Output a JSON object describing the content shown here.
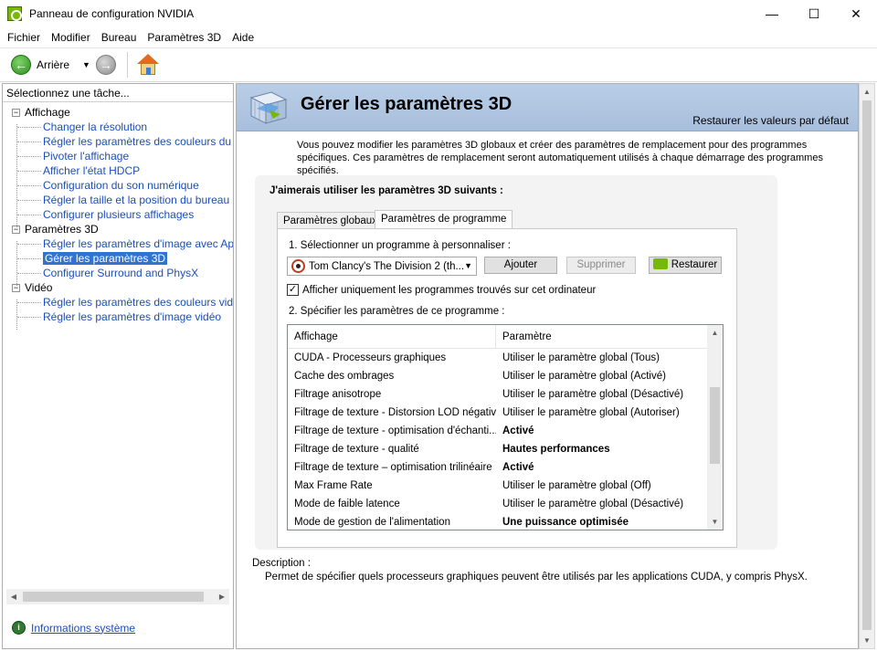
{
  "window": {
    "title": "Panneau de configuration NVIDIA",
    "minimize": "—",
    "maximize": "☐",
    "close": "✕"
  },
  "menu": [
    "Fichier",
    "Modifier",
    "Bureau",
    "Paramètres 3D",
    "Aide"
  ],
  "toolbar": {
    "back_label": "Arrière",
    "back_glyph": "←",
    "forward_glyph": "→",
    "dropdown_glyph": "▼"
  },
  "left_panel": {
    "header": "Sélectionnez une tâche...",
    "groups": [
      {
        "label": "Affichage",
        "items": [
          "Changer la résolution",
          "Régler les paramètres des couleurs du bureau",
          "Pivoter l'affichage",
          "Afficher l'état HDCP",
          "Configuration du son numérique",
          "Régler la taille et la position du bureau",
          "Configurer plusieurs affichages"
        ]
      },
      {
        "label": "Paramètres 3D",
        "items": [
          "Régler les paramètres d'image avec Aperçu",
          "Gérer les paramètres 3D",
          "Configurer Surround and PhysX"
        ]
      },
      {
        "label": "Vidéo",
        "items": [
          "Régler les paramètres des couleurs vidéo",
          "Régler les paramètres d'image vidéo"
        ]
      }
    ],
    "selected_item": "Gérer les paramètres 3D",
    "system_info_link": "Informations système",
    "expander_glyph": "−"
  },
  "main": {
    "title": "Gérer les paramètres 3D",
    "restore_defaults": "Restaurer les valeurs par défaut",
    "intro": "Vous pouvez modifier les paramètres 3D globaux et créer des paramètres de remplacement pour des programmes spécifiques. Ces paramètres de remplacement seront automatiquement utilisés à chaque démarrage des programmes spécifiés.",
    "section_heading": "J'aimerais utiliser les paramètres 3D suivants :",
    "tabs": [
      "Paramètres globaux",
      "Paramètres de programme"
    ],
    "active_tab": "Paramètres de programme",
    "step1_label": "1. Sélectionner un programme à personnaliser :",
    "program_selected": "Tom Clancy's The Division 2 (th...",
    "buttons": {
      "add": "Ajouter",
      "remove": "Supprimer",
      "restore": "Restaurer"
    },
    "checkbox_label": "Afficher uniquement les programmes trouvés sur cet ordinateur",
    "checkbox_checked": true,
    "checkbox_glyph": "✓",
    "step2_label": "2. Spécifier les paramètres de ce programme :",
    "grid": {
      "columns": [
        "Affichage",
        "Paramètre"
      ],
      "rows": [
        {
          "feature": "CUDA - Processeurs graphiques",
          "setting": "Utiliser le paramètre global (Tous)",
          "bold": false
        },
        {
          "feature": "Cache des ombrages",
          "setting": "Utiliser le paramètre global (Activé)",
          "bold": false
        },
        {
          "feature": "Filtrage anisotrope",
          "setting": "Utiliser le paramètre global (Désactivé)",
          "bold": false
        },
        {
          "feature": "Filtrage de texture - Distorsion LOD négative",
          "setting": "Utiliser le paramètre global (Autoriser)",
          "bold": false
        },
        {
          "feature": "Filtrage de texture - optimisation d'échanti...",
          "setting": "Activé",
          "bold": true
        },
        {
          "feature": "Filtrage de texture - qualité",
          "setting": "Hautes performances",
          "bold": true
        },
        {
          "feature": "Filtrage de texture – optimisation trilinéaire",
          "setting": "Activé",
          "bold": true
        },
        {
          "feature": "Max Frame Rate",
          "setting": "Utiliser le paramètre global (Off)",
          "bold": false
        },
        {
          "feature": "Mode de faible latence",
          "setting": "Utiliser le paramètre global (Désactivé)",
          "bold": false
        },
        {
          "feature": "Mode de gestion de l'alimentation",
          "setting": "Une puissance optimisée",
          "bold": true
        }
      ]
    },
    "description_label": "Description :",
    "description_text": "Permet de spécifier quels processeurs graphiques peuvent être utilisés par les applications CUDA, y compris PhysX."
  },
  "scroll_glyphs": {
    "up": "▲",
    "down": "▼",
    "left": "◀",
    "right": "▶"
  },
  "colors": {
    "accent_green": "#76b900",
    "link_blue": "#1a4fb8",
    "selection_blue": "#3173d1",
    "banner_blue": "#b9cde6"
  }
}
